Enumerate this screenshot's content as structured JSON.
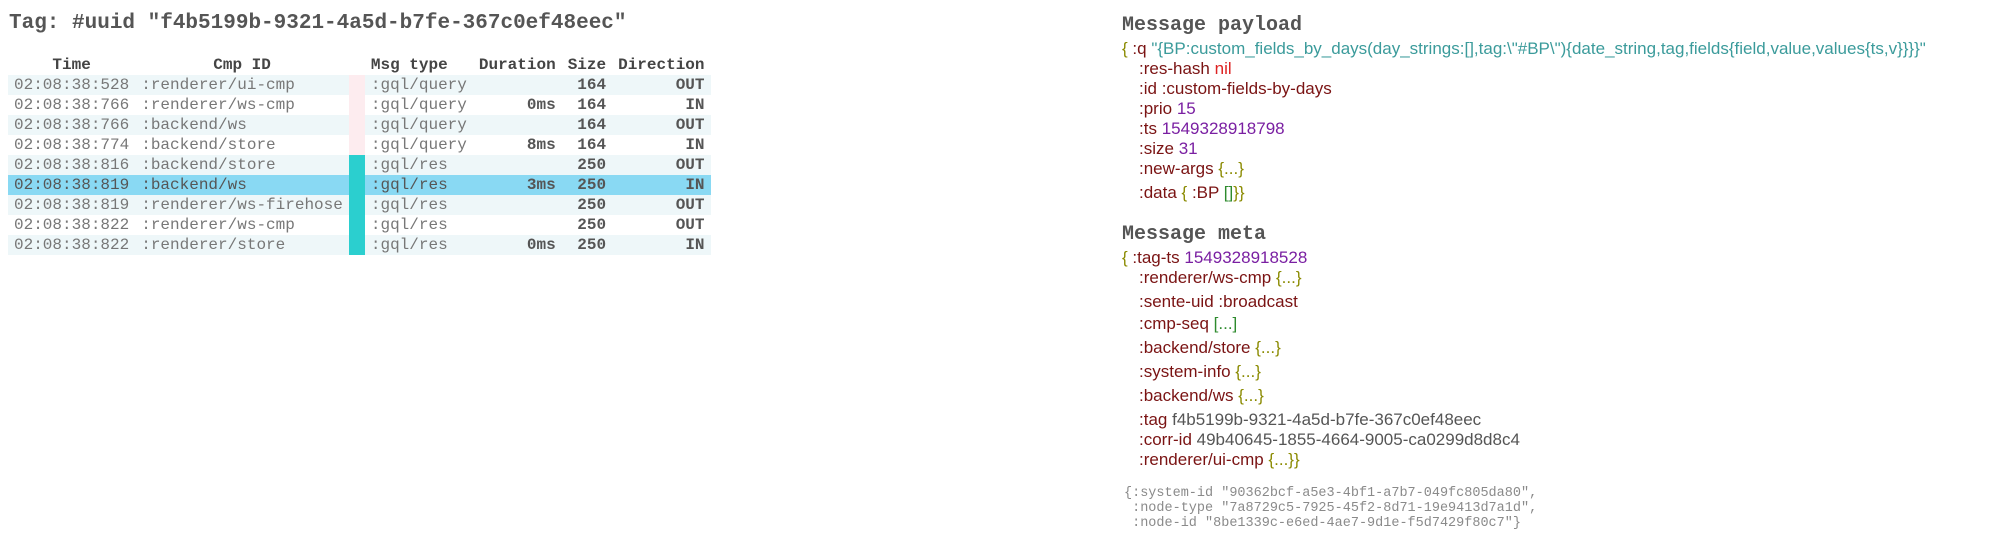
{
  "tag_title": "Tag: #uuid \"f4b5199b-9321-4a5d-b7fe-367c0ef48eec\"",
  "table": {
    "headers": {
      "time": "Time",
      "cmp": "Cmp ID",
      "msg": "Msg type",
      "duration": "Duration",
      "size": "Size",
      "direction": "Direction"
    },
    "rows": [
      {
        "time": "02:08:38:528",
        "cmp": ":renderer/ui-cmp",
        "msg": ":gql/query",
        "duration": "",
        "size": "164",
        "direction": "OUT",
        "marker": "pink",
        "selected": false
      },
      {
        "time": "02:08:38:766",
        "cmp": ":renderer/ws-cmp",
        "msg": ":gql/query",
        "duration": "0ms",
        "size": "164",
        "direction": "IN",
        "marker": "pink",
        "selected": false
      },
      {
        "time": "02:08:38:766",
        "cmp": ":backend/ws",
        "msg": ":gql/query",
        "duration": "",
        "size": "164",
        "direction": "OUT",
        "marker": "pink",
        "selected": false
      },
      {
        "time": "02:08:38:774",
        "cmp": ":backend/store",
        "msg": ":gql/query",
        "duration": "8ms",
        "size": "164",
        "direction": "IN",
        "marker": "pink",
        "selected": false
      },
      {
        "time": "02:08:38:816",
        "cmp": ":backend/store",
        "msg": ":gql/res",
        "duration": "",
        "size": "250",
        "direction": "OUT",
        "marker": "teal",
        "selected": false
      },
      {
        "time": "02:08:38:819",
        "cmp": ":backend/ws",
        "msg": ":gql/res",
        "duration": "3ms",
        "size": "250",
        "direction": "IN",
        "marker": "teal",
        "selected": true
      },
      {
        "time": "02:08:38:819",
        "cmp": ":renderer/ws-firehose",
        "msg": ":gql/res",
        "duration": "",
        "size": "250",
        "direction": "OUT",
        "marker": "teal",
        "selected": false
      },
      {
        "time": "02:08:38:822",
        "cmp": ":renderer/ws-cmp",
        "msg": ":gql/res",
        "duration": "",
        "size": "250",
        "direction": "OUT",
        "marker": "teal",
        "selected": false
      },
      {
        "time": "02:08:38:822",
        "cmp": ":renderer/store",
        "msg": ":gql/res",
        "duration": "0ms",
        "size": "250",
        "direction": "IN",
        "marker": "teal",
        "selected": false
      }
    ]
  },
  "payload": {
    "title": "Message payload",
    "q_key": ":q",
    "q_val": "\"{BP:custom_fields_by_days(day_strings:[],tag:\\\"#BP\\\"){date_string,tag,fields{field,value,values{ts,v}}}}\"",
    "res_hash_key": ":res-hash",
    "res_hash_val": "nil",
    "id_key": ":id",
    "id_val": ":custom-fields-by-days",
    "prio_key": ":prio",
    "prio_val": "15",
    "ts_key": ":ts",
    "ts_val": "1549328918798",
    "size_key": ":size",
    "size_val": "31",
    "new_args_key": ":new-args",
    "collapsed_map": "{...}",
    "data_key": ":data",
    "data_bp": ":BP",
    "empty_vec": "[]"
  },
  "meta": {
    "title": "Message meta",
    "tag_ts_key": ":tag-ts",
    "tag_ts_val": "1549328918528",
    "renderer_ws_cmp": ":renderer/ws-cmp",
    "sente_uid_key": ":sente-uid",
    "sente_uid_val": ":broadcast",
    "cmp_seq_key": ":cmp-seq",
    "cmp_seq_val": "[...]",
    "backend_store": ":backend/store",
    "system_info": ":system-info",
    "backend_ws": ":backend/ws",
    "tag_key": ":tag",
    "tag_val": "f4b5199b-9321-4a5d-b7fe-367c0ef48eec",
    "corr_id_key": ":corr-id",
    "corr_id_val": "49b40645-1855-4664-9005-ca0299d8d8c4",
    "renderer_ui_cmp": ":renderer/ui-cmp",
    "collapsed_map": "{...}"
  },
  "system_info": "{:system-id \"90362bcf-a5e3-4bf1-a7b7-049fc805da80\",\n :node-type \"7a8729c5-7925-45f2-8d71-19e9413d7a1d\",\n :node-id \"8be1339c-e6ed-4ae7-9d1e-f5d7429f80c7\"}",
  "colors": {
    "selected_row": "#89d9f3",
    "query_marker": "#fdecef",
    "res_marker": "#2bcfcf",
    "string": "#3b9b9b",
    "keyword": "#7a1313",
    "number": "#7a1fa2"
  }
}
